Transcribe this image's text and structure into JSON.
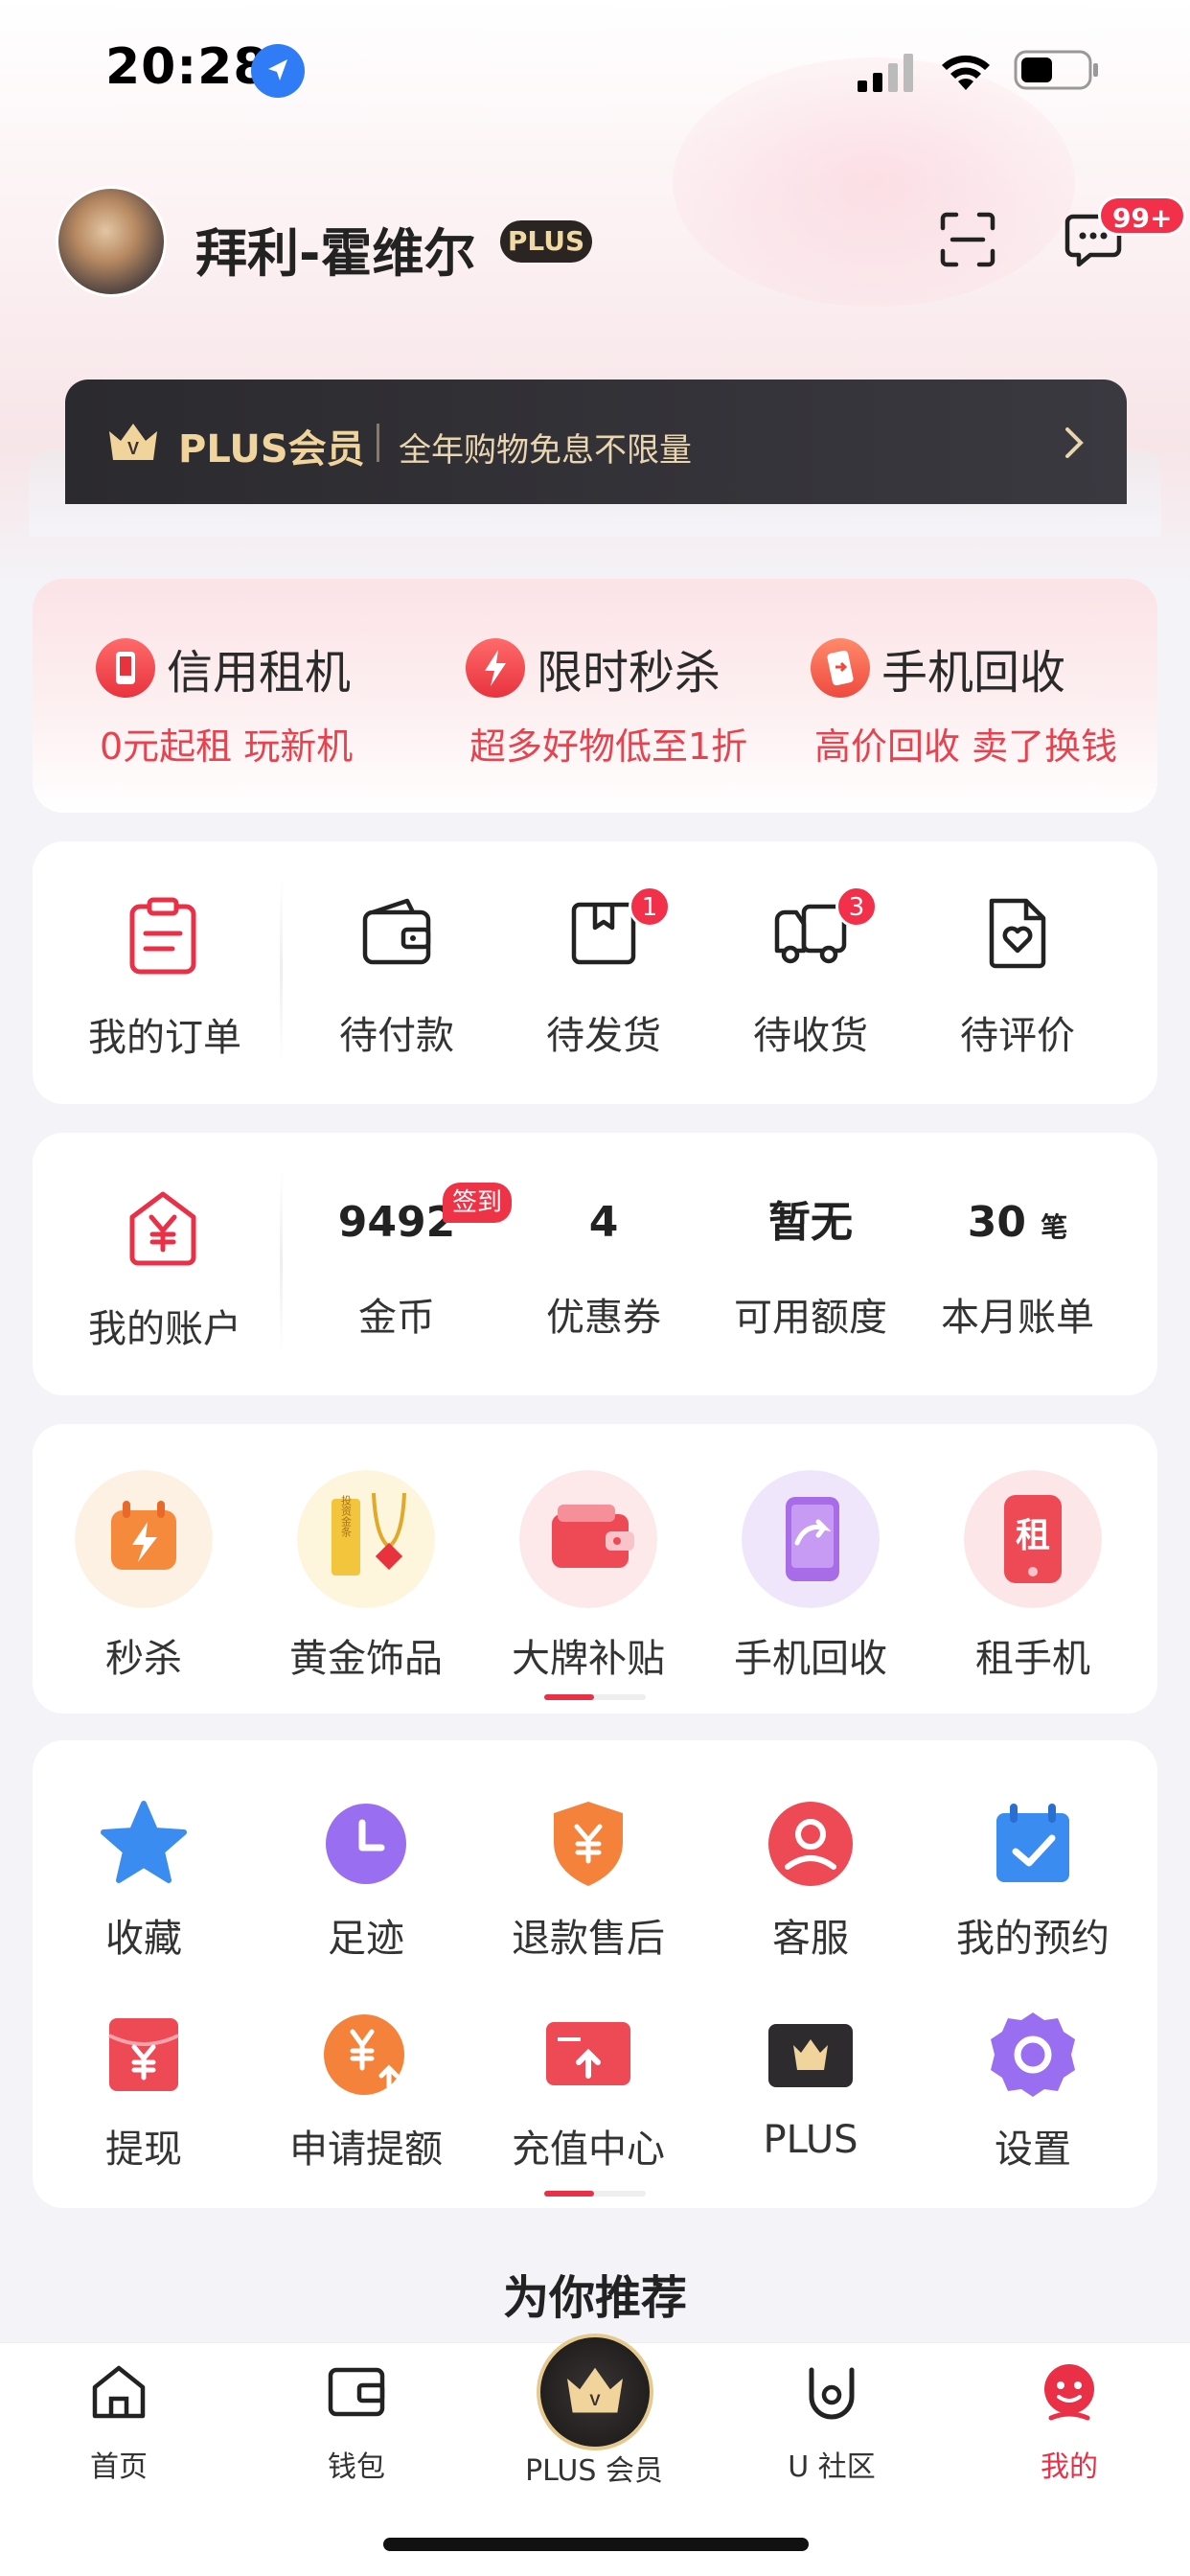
{
  "status_bar": {
    "time": "20:28"
  },
  "profile": {
    "username": "拜利-霍维尔",
    "plus_badge": "PLUS",
    "message_count": "99+"
  },
  "plus_banner": {
    "title": "PLUS会员",
    "subtitle": "全年购物免息不限量"
  },
  "promos": [
    {
      "title": "信用租机",
      "subtitle": "0元起租 玩新机",
      "icon": "phone-icon"
    },
    {
      "title": "限时秒杀",
      "subtitle": "超多好物低至1折",
      "icon": "lightning-icon"
    },
    {
      "title": "手机回收",
      "subtitle": "高价回收 卖了换钱",
      "icon": "recycle-phone-icon"
    }
  ],
  "orders": {
    "label": "我的订单",
    "items": [
      {
        "label": "待付款",
        "badge": ""
      },
      {
        "label": "待发货",
        "badge": "1"
      },
      {
        "label": "待收货",
        "badge": "3"
      },
      {
        "label": "待评价",
        "badge": ""
      }
    ]
  },
  "account": {
    "label": "我的账户",
    "signin_badge": "签到",
    "items": [
      {
        "value": "9492",
        "unit": "",
        "label": "金币"
      },
      {
        "value": "4",
        "unit": "",
        "label": "优惠券"
      },
      {
        "value": "暂无",
        "unit": "",
        "label": "可用额度"
      },
      {
        "value": "30",
        "unit": "笔",
        "label": "本月账单"
      }
    ]
  },
  "features": [
    {
      "label": "秒杀",
      "icon": "flash-sale-icon"
    },
    {
      "label": "黄金饰品",
      "icon": "gold-jewelry-icon",
      "icon_text": "投资金条"
    },
    {
      "label": "大牌补贴",
      "icon": "wallet-subsidy-icon"
    },
    {
      "label": "手机回收",
      "icon": "phone-recycle-icon"
    },
    {
      "label": "租手机",
      "icon": "rent-phone-icon",
      "icon_text": "租"
    }
  ],
  "tools": [
    {
      "label": "收藏",
      "icon": "star-icon"
    },
    {
      "label": "足迹",
      "icon": "clock-icon"
    },
    {
      "label": "退款售后",
      "icon": "refund-shield-icon"
    },
    {
      "label": "客服",
      "icon": "customer-service-icon"
    },
    {
      "label": "我的预约",
      "icon": "calendar-check-icon"
    },
    {
      "label": "提现",
      "icon": "withdraw-envelope-icon"
    },
    {
      "label": "申请提额",
      "icon": "credit-increase-icon"
    },
    {
      "label": "充值中心",
      "icon": "recharge-card-icon"
    },
    {
      "label": "PLUS",
      "icon": "plus-card-icon"
    },
    {
      "label": "设置",
      "icon": "settings-gear-icon"
    }
  ],
  "recommend_title": "为你推荐",
  "tabbar": [
    {
      "label": "首页",
      "active": false
    },
    {
      "label": "钱包",
      "active": false
    },
    {
      "label": "PLUS 会员",
      "active": false
    },
    {
      "label": "U 社区",
      "active": false
    },
    {
      "label": "我的",
      "active": true
    }
  ],
  "colors": {
    "accent": "#ea3047",
    "plus_gold": "#f0d49c",
    "dark": "#2b2a2e"
  }
}
